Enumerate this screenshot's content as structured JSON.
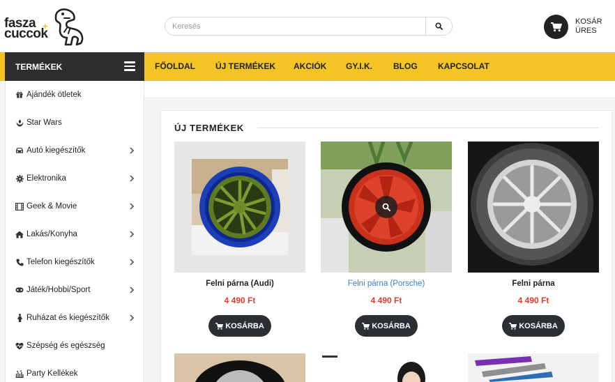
{
  "header": {
    "logo_line1": "fasza",
    "logo_line2": "cuccok",
    "logo_plus": "+",
    "search_placeholder": "Keresés",
    "cart_line1": "KOSÁR",
    "cart_line2": "ÜRES"
  },
  "nav": {
    "categories_label": "TERMÉKEK",
    "links": [
      "FŐOLDAL",
      "ÚJ TERMÉKEK",
      "AKCIÓK",
      "GY.I.K.",
      "BLOG",
      "KAPCSOLAT"
    ]
  },
  "sidebar": {
    "items": [
      {
        "label": "Ajándék ötletek",
        "icon": "gift-icon",
        "has_children": false
      },
      {
        "label": "Star Wars",
        "icon": "rebel-icon",
        "has_children": false
      },
      {
        "label": "Autó kiegészítők",
        "icon": "car-icon",
        "has_children": true
      },
      {
        "label": "Elektronika",
        "icon": "gear-icon",
        "has_children": true
      },
      {
        "label": "Geek & Movie",
        "icon": "film-icon",
        "has_children": true
      },
      {
        "label": "Lakás/Konyha",
        "icon": "home-icon",
        "has_children": true
      },
      {
        "label": "Telefon kiegészítők",
        "icon": "phone-icon",
        "has_children": true
      },
      {
        "label": "Játék/Hobbi/Sport",
        "icon": "gamepad-icon",
        "has_children": true
      },
      {
        "label": "Ruházat és kiegészítők",
        "icon": "person-icon",
        "has_children": true
      },
      {
        "label": "Szépség és egészség",
        "icon": "heartbeat-icon",
        "has_children": false
      },
      {
        "label": "Party Kellékek",
        "icon": "party-icon",
        "has_children": false
      }
    ]
  },
  "main": {
    "section_title": "ÚJ TERMÉKEK",
    "buy_label": "KOSÁRBA",
    "products": [
      {
        "name": "Felni párna (Audi)",
        "price": "4 490 Ft",
        "rim_color": "#6b8a2a",
        "tire_color": "#1e3fb0"
      },
      {
        "name": "Felni párna (Porsche)",
        "price": "4 490 Ft",
        "rim_color": "#d63b25",
        "tire_color": "#111111"
      },
      {
        "name": "Felni párna",
        "price": "4 490 Ft",
        "rim_color": "#c8c8c8",
        "tire_color": "#3a3a3a"
      }
    ]
  },
  "colors": {
    "accent_yellow": "#f4c425",
    "dark": "#2d2d2d",
    "price_red": "#e03b2e",
    "link_blue": "#3a7fb8"
  }
}
